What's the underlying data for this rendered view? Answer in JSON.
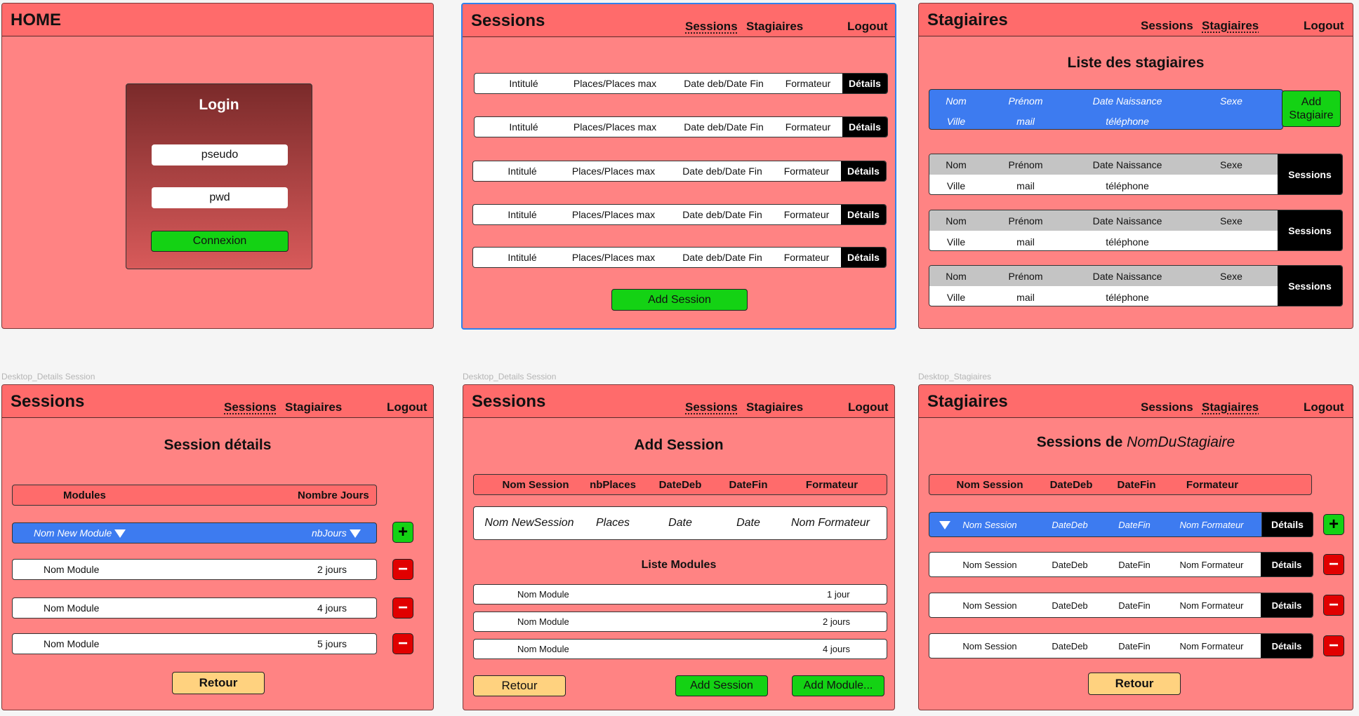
{
  "home": {
    "title": "HOME",
    "login": {
      "title": "Login",
      "pseudo": "pseudo",
      "pwd": "pwd",
      "button": "Connexion"
    }
  },
  "sessions_list": {
    "title": "Sessions",
    "nav": {
      "sessions": "Sessions",
      "stagiaires": "Stagiaires",
      "logout": "Logout"
    },
    "row": {
      "intitule": "Intitulé",
      "places": "Places/Places max",
      "dates": "Date deb/Date Fin",
      "formateur": "Formateur",
      "details": "Détails"
    },
    "add_button": "Add Session"
  },
  "stagiaires_list": {
    "title": "Stagiaires",
    "nav": {
      "sessions": "Sessions",
      "stagiaires": "Stagiaires",
      "logout": "Logout"
    },
    "heading": "Liste des stagiaires",
    "fields": {
      "nom": "Nom",
      "prenom": "Prénom",
      "date_naissance": "Date Naissance",
      "sexe": "Sexe",
      "ville": "Ville",
      "mail": "mail",
      "telephone": "téléphone"
    },
    "add_button_line1": "Add",
    "add_button_line2": "Stagiaire",
    "sessions_button": "Sessions"
  },
  "details_session": {
    "caption": "Desktop_Details Session",
    "title": "Sessions",
    "nav": {
      "sessions": "Sessions",
      "stagiaires": "Stagiaires",
      "logout": "Logout"
    },
    "heading": "Session détails",
    "table_header": {
      "modules": "Modules",
      "nombre_jours": "Nombre Jours"
    },
    "new_module": {
      "name": "Nom New Module",
      "days": "nbJours"
    },
    "modules": [
      {
        "name": "Nom Module",
        "days": "2 jours"
      },
      {
        "name": "Nom Module",
        "days": "4 jours"
      },
      {
        "name": "Nom Module",
        "days": "5 jours"
      }
    ],
    "back_button": "Retour"
  },
  "add_session": {
    "caption": "Desktop_Details Session",
    "title": "Sessions",
    "nav": {
      "sessions": "Sessions",
      "stagiaires": "Stagiaires",
      "logout": "Logout"
    },
    "heading": "Add Session",
    "table_header": {
      "nom": "Nom Session",
      "places": "nbPlaces",
      "deb": "DateDeb",
      "fin": "DateFin",
      "formateur": "Formateur"
    },
    "input_row": {
      "nom": "Nom NewSession",
      "places": "Places",
      "deb": "Date",
      "fin": "Date",
      "formateur": "Nom Formateur"
    },
    "modules_heading": "Liste Modules",
    "modules": [
      {
        "name": "Nom Module",
        "days": "1 jour"
      },
      {
        "name": "Nom Module",
        "days": "2 jours"
      },
      {
        "name": "Nom Module",
        "days": "4 jours"
      }
    ],
    "back_button": "Retour",
    "add_session_button": "Add Session",
    "add_module_button": "Add Module..."
  },
  "stagiaire_sessions": {
    "caption": "Desktop_Stagiaires",
    "title": "Stagiaires",
    "nav": {
      "sessions": "Sessions",
      "stagiaires": "Stagiaires",
      "logout": "Logout"
    },
    "heading_prefix": "Sessions de ",
    "heading_name": "NomDuStagiaire",
    "table_header": {
      "nom": "Nom Session",
      "deb": "DateDeb",
      "fin": "DateFin",
      "formateur": "Formateur"
    },
    "row": {
      "nom": "Nom Session",
      "deb": "DateDeb",
      "fin": "DateFin",
      "formateur": "Nom Formateur",
      "details": "Détails"
    },
    "back_button": "Retour"
  }
}
